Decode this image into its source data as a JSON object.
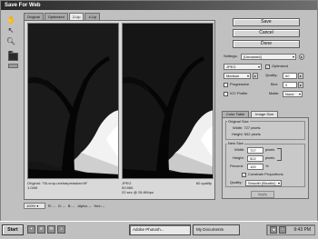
{
  "window": {
    "title": "Save For Web"
  },
  "tabs": [
    {
      "label": "Original"
    },
    {
      "label": "Optimized"
    },
    {
      "label": "2-Up"
    },
    {
      "label": "4-Up"
    }
  ],
  "preview": {
    "left": {
      "line1": "Original: \"06-crop-unsharpmasked.tif\"",
      "line2": "1.04M"
    },
    "right": {
      "line1": "JPEG",
      "line1_right": "60 quality",
      "line2": "53.56K",
      "line3": "22 sec @ 28.8Kbps"
    }
  },
  "statusbar": {
    "zoom": "100%",
    "r": "R: --",
    "g": "G: --",
    "b": "B: --",
    "alpha": "Alpha: --",
    "hex": "Hex: --"
  },
  "buttons": {
    "save": "Save",
    "cancel": "Cancel",
    "done": "Done"
  },
  "settings": {
    "label": "Settings:",
    "preset": "[Unnamed]",
    "format": "JPEG",
    "optimized_label": "Optimized",
    "optimized_checked": true,
    "compression": "Medium",
    "quality_label": "Quality:",
    "quality": "60",
    "progressive_label": "Progressive",
    "blur_label": "Blur:",
    "blur": "0",
    "icc_label": "ICC Profile",
    "matte_label": "Matte:",
    "matte": "None"
  },
  "panel": {
    "tabs": [
      {
        "label": "Color Table"
      },
      {
        "label": "Image Size"
      }
    ],
    "original_size": {
      "title": "Original Size",
      "width": "Width: 727 pixels",
      "height": "Height: 502 pixels"
    },
    "new_size": {
      "title": "New Size",
      "width_label": "Width:",
      "width": "727",
      "height_label": "Height:",
      "height": "502",
      "percent_label": "Percent:",
      "percent": "100",
      "unit": "pixels",
      "percent_unit": "%",
      "constrain_label": "Constrain Proportions",
      "constrain_checked": true,
      "quality_label": "Quality:",
      "quality": "Smooth (Bicubic)"
    },
    "apply": "Apply"
  },
  "taskbar": {
    "start": "Start",
    "tasks": [
      {
        "label": "Adobe Photosh..."
      },
      {
        "label": "My Documents"
      }
    ],
    "clock": "9:43 PM"
  },
  "colors": {
    "titlebar": "#3a3a3a",
    "preview_bg": "#141414"
  }
}
